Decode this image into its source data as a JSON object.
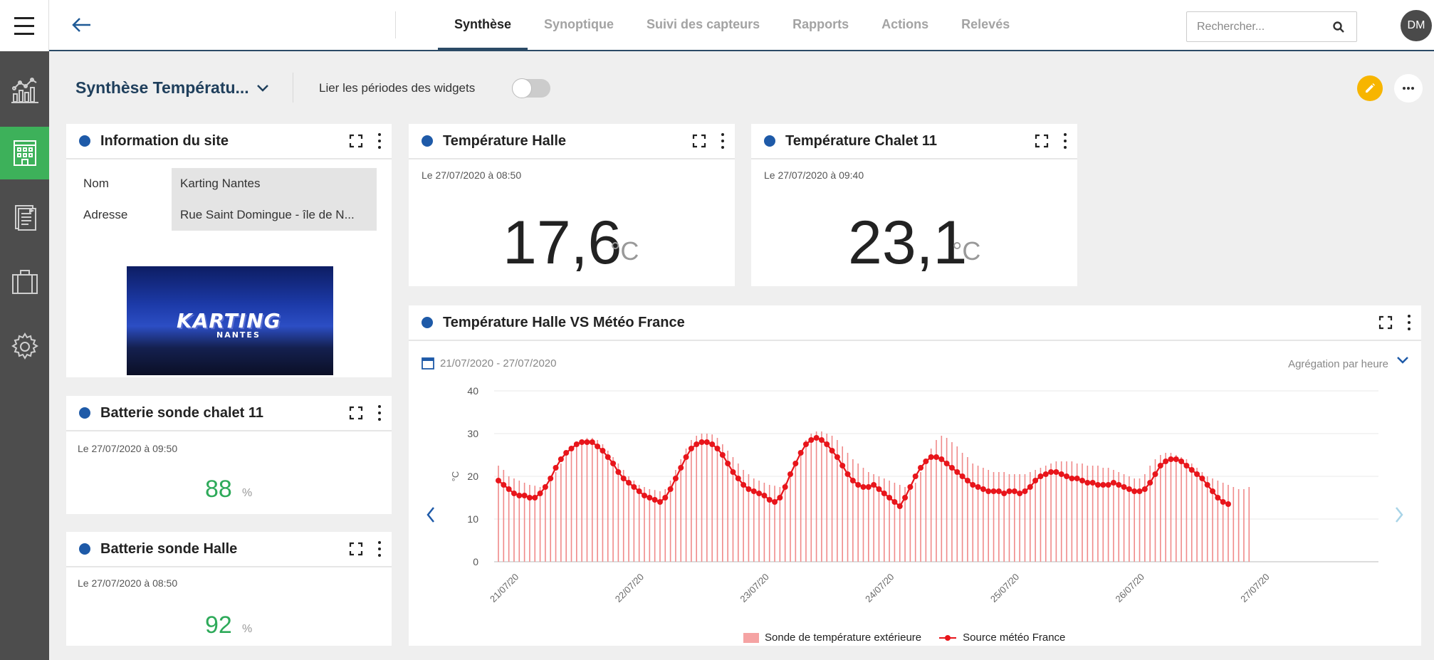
{
  "nav": {
    "tabs": [
      {
        "label": "Synthèse",
        "active": true
      },
      {
        "label": "Synoptique",
        "active": false
      },
      {
        "label": "Suivi des capteurs",
        "active": false
      },
      {
        "label": "Rapports",
        "active": false
      },
      {
        "label": "Actions",
        "active": false
      },
      {
        "label": "Relevés",
        "active": false
      }
    ],
    "search_placeholder": "Rechercher...",
    "avatar_initials": "DM"
  },
  "sidebar": {
    "items": [
      {
        "icon": "chart-icon",
        "active": false
      },
      {
        "icon": "building-icon",
        "active": true
      },
      {
        "icon": "report-icon",
        "active": false
      },
      {
        "icon": "briefcase-icon",
        "active": false
      },
      {
        "icon": "gear-icon",
        "active": false
      }
    ],
    "active_color": "#3db15a"
  },
  "dashboard": {
    "title": "Synthèse Températu...",
    "link_periods_label": "Lier les périodes des widgets",
    "link_periods_on": false
  },
  "widgets": {
    "site_info": {
      "title": "Information du site",
      "rows": [
        {
          "key": "Nom",
          "value": "Karting Nantes"
        },
        {
          "key": "Adresse",
          "value": "Rue Saint Domingue - île de N..."
        }
      ],
      "image_logo": "KARTING",
      "image_logo_sub": "NANTES"
    },
    "temp_halle": {
      "title": "Température Halle",
      "timestamp": "Le 27/07/2020 à 08:50",
      "value": "17,6",
      "unit": "°C"
    },
    "temp_chalet": {
      "title": "Température Chalet 11",
      "timestamp": "Le 27/07/2020 à 09:40",
      "value": "23,1",
      "unit": "°C"
    },
    "batt_chalet": {
      "title": "Batterie sonde chalet 11",
      "timestamp": "Le 27/07/2020 à 09:50",
      "value": "88",
      "unit": "%"
    },
    "batt_halle": {
      "title": "Batterie sonde Halle",
      "timestamp": "Le 27/07/2020 à 08:50",
      "value": "92",
      "unit": "%"
    },
    "chart": {
      "title": "Température Halle VS Météo France",
      "date_range": "21/07/2020 - 27/07/2020",
      "aggregation": "Agrégation par heure"
    }
  },
  "colors": {
    "primary": "#1f3f5c",
    "dot": "#1e5aa8",
    "bar": "#f5a3a3",
    "line": "#e8151b",
    "battery": "#2eaa5a",
    "edit": "#f7b500"
  },
  "chart_data": {
    "type": "bar",
    "ylabel": "°C",
    "ylim": [
      0,
      40
    ],
    "yticks": [
      0,
      10,
      20,
      30,
      40
    ],
    "xticks": [
      "21/07/20",
      "22/07/20",
      "23/07/20",
      "24/07/20",
      "25/07/20",
      "26/07/20",
      "27/07/20"
    ],
    "series": [
      {
        "name": "Sonde de température extérieure",
        "kind": "bar",
        "values": [
          22.5,
          21.5,
          20.0,
          19.5,
          19.0,
          18.5,
          18.0,
          17.8,
          17.5,
          17.8,
          19.0,
          21.0,
          23.0,
          25.0,
          26.5,
          27.5,
          28.5,
          29.0,
          29.0,
          28.5,
          27.5,
          26.0,
          24.5,
          23.0,
          21.5,
          20.0,
          19.0,
          18.0,
          17.5,
          17.0,
          16.8,
          16.5,
          17.0,
          19.0,
          21.5,
          24.0,
          26.5,
          28.5,
          29.5,
          30.0,
          30.0,
          29.8,
          29.0,
          27.5,
          26.0,
          24.5,
          23.0,
          21.5,
          20.5,
          19.5,
          19.0,
          18.5,
          18.0,
          17.8,
          17.5,
          18.5,
          21.0,
          23.5,
          26.0,
          28.5,
          30.0,
          30.5,
          30.5,
          30.0,
          29.5,
          28.5,
          27.0,
          25.5,
          24.0,
          23.0,
          22.0,
          21.0,
          20.5,
          20.0,
          19.5,
          19.0,
          18.5,
          18.0,
          17.5,
          17.0,
          18.5,
          21.0,
          24.0,
          26.5,
          28.5,
          29.5,
          29.0,
          28.0,
          27.0,
          25.5,
          24.5,
          23.0,
          22.5,
          22.0,
          21.5,
          21.0,
          21.0,
          21.0,
          20.5,
          20.5,
          20.5,
          20.5,
          21.0,
          21.5,
          22.0,
          22.5,
          23.0,
          23.5,
          23.5,
          23.5,
          23.5,
          23.0,
          23.0,
          22.5,
          22.5,
          22.5,
          22.0,
          22.0,
          21.5,
          21.0,
          20.5,
          20.0,
          19.5,
          19.5,
          20.5,
          22.5,
          24.0,
          25.0,
          25.5,
          25.5,
          25.0,
          24.5,
          24.0,
          23.0,
          22.0,
          21.0,
          20.0,
          19.5,
          19.0,
          18.5,
          18.0,
          17.5,
          17.0,
          17.0,
          17.5
        ]
      },
      {
        "name": "Source météo France",
        "kind": "line",
        "values": [
          19.0,
          18.0,
          17.0,
          16.0,
          15.5,
          15.5,
          15.0,
          15.0,
          16.0,
          17.5,
          19.5,
          22.0,
          24.0,
          25.5,
          26.5,
          27.5,
          28.0,
          28.0,
          28.0,
          27.0,
          26.0,
          24.5,
          23.0,
          21.0,
          19.5,
          18.5,
          17.5,
          16.5,
          15.5,
          15.0,
          14.5,
          14.0,
          15.0,
          17.0,
          19.5,
          22.0,
          24.5,
          26.5,
          27.5,
          28.0,
          28.0,
          27.5,
          26.5,
          25.0,
          23.0,
          21.0,
          19.5,
          18.0,
          17.0,
          16.5,
          16.0,
          15.5,
          14.5,
          14.0,
          15.0,
          17.5,
          20.5,
          23.0,
          25.5,
          27.5,
          28.5,
          29.0,
          28.5,
          27.5,
          26.0,
          24.5,
          22.5,
          20.5,
          19.0,
          18.0,
          17.5,
          17.5,
          18.0,
          17.0,
          16.0,
          15.0,
          14.0,
          13.0,
          15.0,
          17.5,
          20.0,
          22.0,
          23.5,
          24.5,
          24.5,
          24.0,
          23.0,
          22.0,
          21.0,
          20.0,
          19.0,
          18.0,
          17.5,
          17.0,
          16.5,
          16.5,
          16.5,
          16.0,
          16.5,
          16.5,
          16.0,
          16.5,
          17.5,
          19.0,
          20.0,
          20.5,
          21.0,
          21.0,
          20.5,
          20.0,
          19.5,
          19.5,
          19.0,
          18.5,
          18.5,
          18.0,
          18.0,
          18.0,
          18.5,
          18.0,
          17.5,
          17.0,
          16.5,
          16.5,
          17.0,
          18.5,
          20.5,
          22.5,
          23.5,
          24.0,
          24.0,
          23.5,
          22.5,
          21.5,
          20.5,
          19.5,
          18.0,
          16.5,
          15.0,
          14.0,
          13.5
        ]
      }
    ],
    "legend": [
      "Sonde de température extérieure",
      "Source météo France"
    ],
    "grid": true,
    "legend_position": "bottom"
  }
}
